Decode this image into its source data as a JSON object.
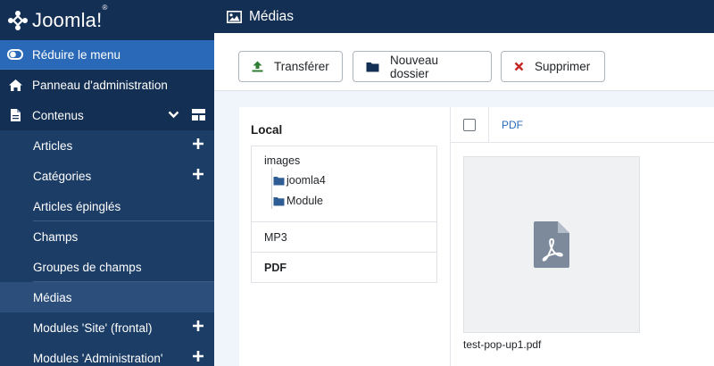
{
  "brand": {
    "name": "Joomla!",
    "name_main": "Joomla",
    "name_mark": "!",
    "registered": "®"
  },
  "sidebar": {
    "toggle_label": "Réduire le menu",
    "dashboard_label": "Panneau d'administration",
    "content_label": "Contenus",
    "items": [
      {
        "label": "Articles",
        "has_add": true
      },
      {
        "label": "Catégories",
        "has_add": true
      },
      {
        "label": "Articles épinglés",
        "has_add": false
      },
      {
        "label": "Champs",
        "has_add": false
      },
      {
        "label": "Groupes de champs",
        "has_add": false
      },
      {
        "label": "Médias",
        "has_add": false,
        "active": true
      },
      {
        "label": "Modules 'Site' (frontal)",
        "has_add": true
      },
      {
        "label": "Modules 'Administration'",
        "has_add": true
      }
    ]
  },
  "header": {
    "title": "Médias",
    "icon": "image-icon"
  },
  "toolbar": {
    "upload_label": "Transférer",
    "new_folder_label": "Nouveau dossier",
    "delete_label": "Supprimer"
  },
  "tree": {
    "title": "Local",
    "root": "images",
    "subfolders": [
      "joomla4",
      "Module"
    ],
    "folders": [
      "MP3",
      "PDF"
    ]
  },
  "browser": {
    "breadcrumb": "PDF",
    "files": [
      {
        "name": "test-pop-up1.pdf",
        "icon": "file-pdf-icon"
      }
    ]
  },
  "colors": {
    "sidebar_bg": "#132f53",
    "sidebar_child_bg": "#1c3d66",
    "accent": "#2a69b8",
    "upload_green": "#2f7d32",
    "delete_red": "#c52827",
    "folder_blue": "#2e5d95"
  }
}
